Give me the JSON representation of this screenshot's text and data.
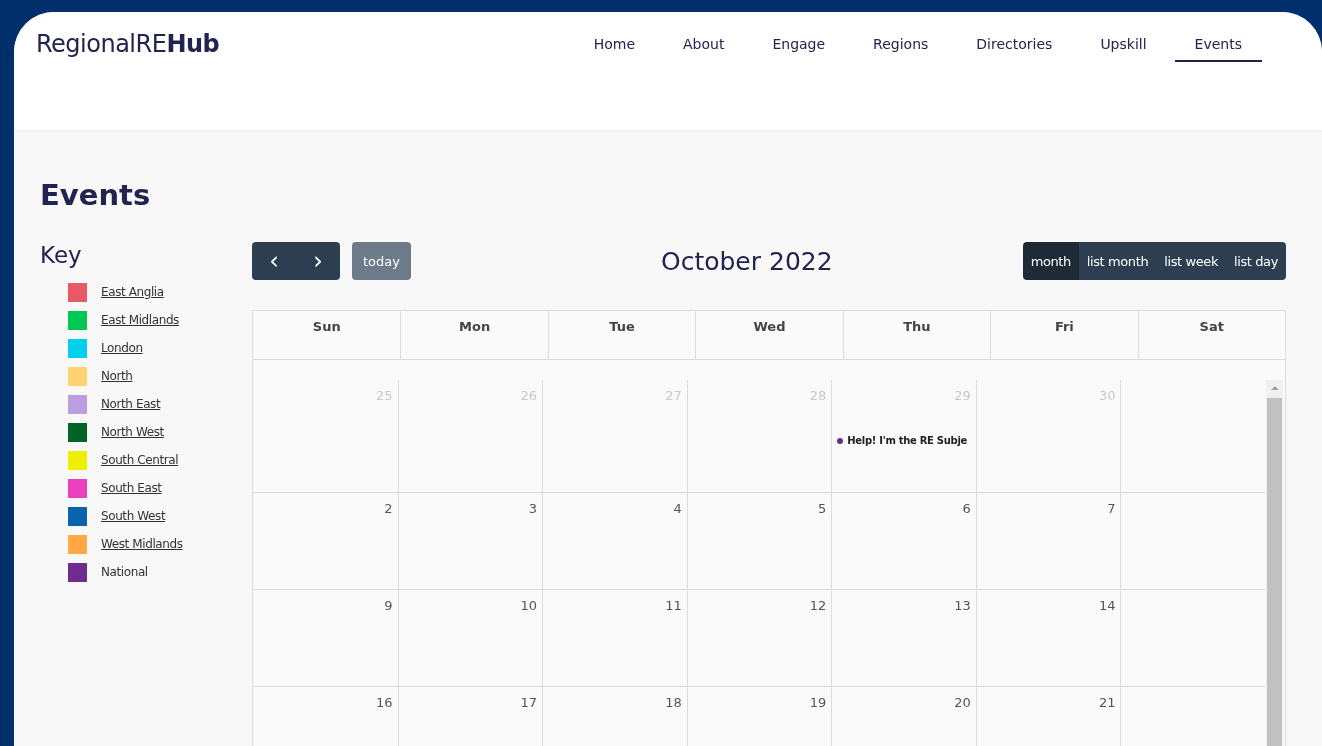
{
  "logo": {
    "light": "RegionalRE",
    "bold": "Hub"
  },
  "nav": [
    {
      "label": "Home",
      "selected": false
    },
    {
      "label": "About",
      "selected": false
    },
    {
      "label": "Engage",
      "selected": false
    },
    {
      "label": "Regions",
      "selected": false
    },
    {
      "label": "Directories",
      "selected": false
    },
    {
      "label": "Upskill",
      "selected": false
    },
    {
      "label": "Events",
      "selected": true
    }
  ],
  "page_title": "Events",
  "key": {
    "title": "Key",
    "items": [
      {
        "label": "East Anglia",
        "color": "#e85a63",
        "link": true
      },
      {
        "label": "East Midlands",
        "color": "#00c853",
        "link": true
      },
      {
        "label": "London",
        "color": "#00d0f0",
        "link": true
      },
      {
        "label": "North",
        "color": "#ffd470",
        "link": true
      },
      {
        "label": "North East",
        "color": "#bb9ee0",
        "link": true
      },
      {
        "label": "North West",
        "color": "#006428",
        "link": true
      },
      {
        "label": "South Central",
        "color": "#eef000",
        "link": true
      },
      {
        "label": "South East",
        "color": "#ea3fbf",
        "link": true
      },
      {
        "label": "South West",
        "color": "#0a63ad",
        "link": true
      },
      {
        "label": "West Midlands",
        "color": "#ffa845",
        "link": true
      },
      {
        "label": "National",
        "color": "#6f2c8e",
        "link": false
      }
    ]
  },
  "calendar": {
    "prev": "‹",
    "next": "›",
    "today": "today",
    "title": "October 2022",
    "views": [
      {
        "label": "month",
        "selected": true
      },
      {
        "label": "list month",
        "selected": false
      },
      {
        "label": "list week",
        "selected": false
      },
      {
        "label": "list day",
        "selected": false
      }
    ],
    "weekdays": [
      "Sun",
      "Mon",
      "Tue",
      "Wed",
      "Thu",
      "Fri",
      "Sat"
    ],
    "weeks": [
      [
        {
          "day": "25",
          "muted": true
        },
        {
          "day": "26",
          "muted": true
        },
        {
          "day": "27",
          "muted": true
        },
        {
          "day": "28",
          "muted": true
        },
        {
          "day": "29",
          "muted": true,
          "events": [
            {
              "title": "Help! I'm the RE Subje",
              "color": "#6f2c8e"
            }
          ]
        },
        {
          "day": "30",
          "muted": true
        }
      ],
      [
        {
          "day": "2",
          "muted": false
        },
        {
          "day": "3",
          "muted": false
        },
        {
          "day": "4",
          "muted": false
        },
        {
          "day": "5",
          "muted": false
        },
        {
          "day": "6",
          "muted": false
        },
        {
          "day": "7",
          "muted": false
        }
      ],
      [
        {
          "day": "9",
          "muted": false
        },
        {
          "day": "10",
          "muted": false
        },
        {
          "day": "11",
          "muted": false
        },
        {
          "day": "12",
          "muted": false
        },
        {
          "day": "13",
          "muted": false
        },
        {
          "day": "14",
          "muted": false
        }
      ],
      [
        {
          "day": "16",
          "muted": false
        },
        {
          "day": "17",
          "muted": false
        },
        {
          "day": "18",
          "muted": false
        },
        {
          "day": "19",
          "muted": false
        },
        {
          "day": "20",
          "muted": false
        },
        {
          "day": "21",
          "muted": false
        }
      ]
    ]
  }
}
